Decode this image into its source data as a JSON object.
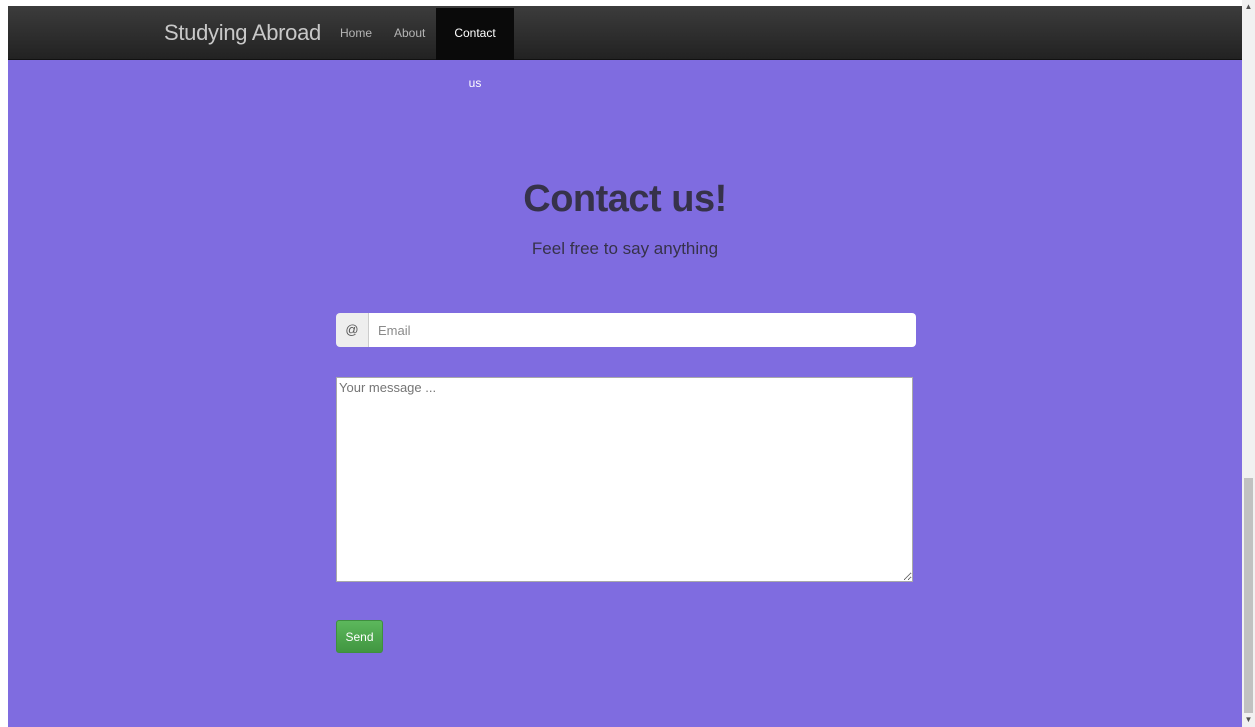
{
  "navbar": {
    "brand": "Studying Abroad",
    "items": [
      {
        "label": "Home",
        "active": false
      },
      {
        "label": "About",
        "active": false
      },
      {
        "label": "Contact us",
        "active": true
      }
    ]
  },
  "hero": {
    "title": "Contact us!",
    "subtitle": "Feel free to say anything"
  },
  "form": {
    "email_addon": "@",
    "email_placeholder": "Email",
    "email_value": "",
    "message_placeholder": "Your message ...",
    "message_value": "",
    "send_label": "Send"
  },
  "colors": {
    "background": "#7f6ce0",
    "navbar": "#2b2b2b",
    "send_button": "#4cae4c"
  },
  "icons": {
    "scroll_up": "triangle-up-icon",
    "scroll_down": "triangle-down-icon"
  }
}
